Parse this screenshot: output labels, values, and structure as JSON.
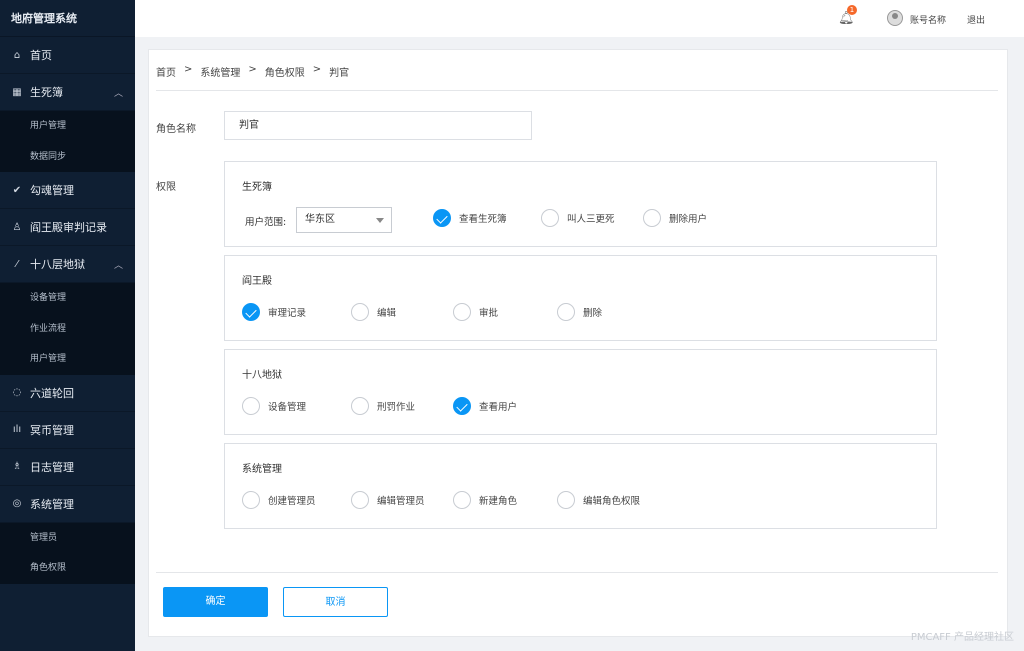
{
  "app_title": "地府管理系统",
  "sidebar": {
    "home": "首页",
    "book": "生死簿",
    "book_sub": [
      "用户管理",
      "数据同步"
    ],
    "soul": "勾魂管理",
    "yama": "阎王殿审判记录",
    "hell": "十八层地狱",
    "hell_sub": [
      "设备管理",
      "作业流程",
      "用户管理"
    ],
    "reincarnation": "六道轮回",
    "money": "冥币管理",
    "log": "日志管理",
    "system": "系统管理",
    "system_sub": [
      "管理员",
      "角色权限"
    ]
  },
  "header": {
    "notification_count": "1",
    "account": "账号名称",
    "logout": "退出"
  },
  "breadcrumb": [
    "首页",
    "系统管理",
    "角色权限",
    "判官"
  ],
  "breadcrumb_sep": ">",
  "form": {
    "role_label": "角色名称",
    "role_value": "判官",
    "perm_label": "权限",
    "groups": [
      {
        "title": "生死簿",
        "scope_label": "用户范围:",
        "scope_value": "华东区",
        "options": [
          {
            "label": "查看生死簿",
            "checked": true
          },
          {
            "label": "叫人三更死",
            "checked": false
          },
          {
            "label": "删除用户",
            "checked": false
          }
        ]
      },
      {
        "title": "阎王殿",
        "options": [
          {
            "label": "审理记录",
            "checked": true
          },
          {
            "label": "编辑",
            "checked": false
          },
          {
            "label": "审批",
            "checked": false
          },
          {
            "label": "删除",
            "checked": false
          }
        ]
      },
      {
        "title": "十八地狱",
        "options": [
          {
            "label": "设备管理",
            "checked": false
          },
          {
            "label": "刑罚作业",
            "checked": false
          },
          {
            "label": "查看用户",
            "checked": true
          }
        ]
      },
      {
        "title": "系统管理",
        "options": [
          {
            "label": "创建管理员",
            "checked": false
          },
          {
            "label": "编辑管理员",
            "checked": false
          },
          {
            "label": "新建角色",
            "checked": false
          },
          {
            "label": "编辑角色权限",
            "checked": false
          }
        ]
      }
    ],
    "confirm": "确定",
    "cancel": "取消"
  },
  "watermark": "PMCAFF 产品经理社区"
}
